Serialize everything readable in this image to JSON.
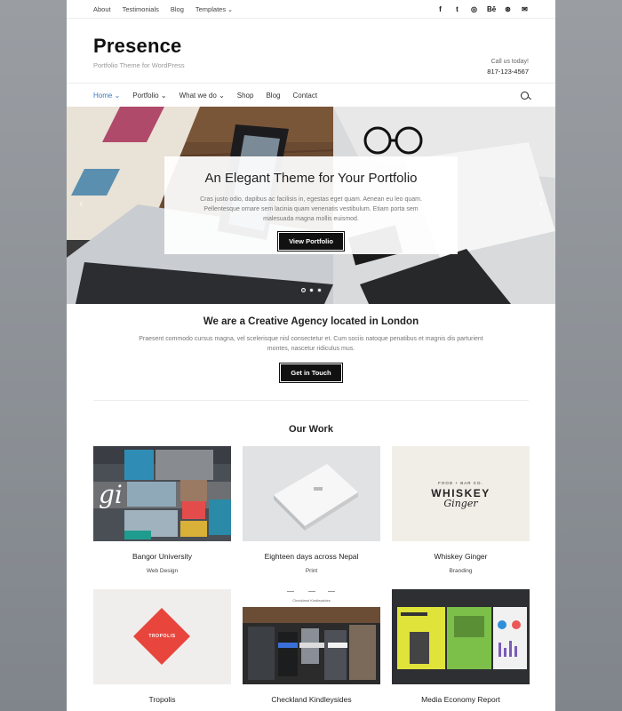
{
  "topbar": {
    "links": [
      "About",
      "Testimonials",
      "Blog",
      "Templates"
    ],
    "social_icons": [
      "facebook-icon",
      "twitter-icon",
      "instagram-icon",
      "behance-icon",
      "dribbble-icon",
      "email-icon"
    ],
    "social_glyphs": [
      "f",
      "t",
      "◎",
      "Bē",
      "⊛",
      "✉"
    ]
  },
  "header": {
    "title": "Presence",
    "tagline": "Portfolio Theme for WordPress",
    "call_label": "Call us today!",
    "phone": "817-123-4567"
  },
  "nav": {
    "items": [
      "Home",
      "Portfolio",
      "What we do",
      "Shop",
      "Blog",
      "Contact"
    ],
    "active": "Home"
  },
  "hero": {
    "title": "An Elegant Theme for Your Portfolio",
    "text": "Cras justo odio, dapibus ac facilisis in, egestas eget quam. Aenean eu leo quam. Pellentesque ornare sem lacinia quam venenatis vestibulum. Etiam porta sem malesuada magna mollis euismod.",
    "button": "View Portfolio",
    "slides": 3,
    "active_slide": 1
  },
  "intro": {
    "title": "We are a Creative Agency located in London",
    "text": "Praesent commodo cursus magna, vel scelerisque nisl consectetur et. Cum sociis natoque penatibus et magnis dis parturient montes, nascetur ridiculus mus.",
    "button": "Get in Touch"
  },
  "work": {
    "title": "Our Work",
    "items": [
      {
        "title": "Bangor University",
        "category": "Web Design"
      },
      {
        "title": "Eighteen days across Nepal",
        "category": "Print"
      },
      {
        "title": "Whiskey Ginger",
        "category": "Branding"
      },
      {
        "title": "Tropolis",
        "category": ""
      },
      {
        "title": "Checkland Kindleysides",
        "category": ""
      },
      {
        "title": "Media Economy Report",
        "category": ""
      }
    ],
    "thumb_text": {
      "whiskey_top": "FOOD + BAR CO.",
      "whiskey_main": "WHISKEY",
      "whiskey_script": "Ginger",
      "tropolis": "TROPOLIS",
      "checkland_caption": "Checkland Kindleysides",
      "bangor_script": "gi"
    }
  },
  "colors": {
    "accent": "#3b7bbf",
    "button": "#111111",
    "tropolis_red": "#e8453c"
  }
}
